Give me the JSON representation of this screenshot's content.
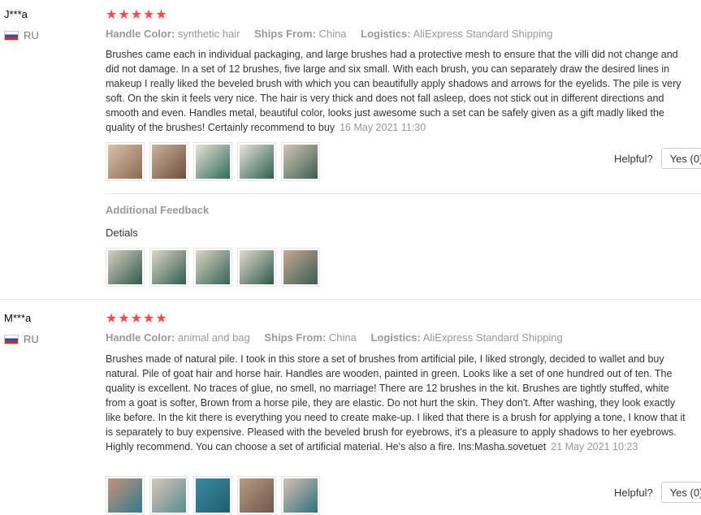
{
  "reviews": [
    {
      "user": "J***a",
      "country": "RU",
      "stars": "★★★★★",
      "attrs": {
        "handle_label": "Handle Color:",
        "handle_value": "synthetic hair",
        "ships_label": "Ships From:",
        "ships_value": "China",
        "logistics_label": "Logistics:",
        "logistics_value": "AliExpress Standard Shipping"
      },
      "text": "Brushes came each in individual packaging, and large brushes had a protective mesh to ensure that the villi did not change and did not damage. In a set of 12 brushes, five large and six small. With each brush, you can separately draw the desired lines in makeup I really liked the beveled brush with which you can beautifully apply shadows and arrows for the eyelids. The pile is very soft. On the skin it feels very nice. The hair is very thick and does not fall asleep, does not stick out in different directions and smooth and even. Handles metal, beautiful color, looks just awesome such a set can be safely given as a gift madly liked the quality of the brushes! Certainly recommend to buy",
      "date": "16 May 2021 11:30",
      "helpful_label": "Helpful?",
      "yes_label": "Yes (0)",
      "additional_title": "Additional Feedback",
      "additional_text": "Detials"
    },
    {
      "user": "M***a",
      "country": "RU",
      "stars": "★★★★★",
      "attrs": {
        "handle_label": "Handle Color:",
        "handle_value": "animal and bag",
        "ships_label": "Ships From:",
        "ships_value": "China",
        "logistics_label": "Logistics:",
        "logistics_value": "AliExpress Standard Shipping"
      },
      "text": "Brushes made of natural pile. I took in this store a set of brushes from artificial pile, I liked strongly, decided to wallet and buy natural. Pile of goat hair and horse hair. Handles are wooden, painted in green. Looks like a set of one hundred out of ten. The quality is excellent. No traces of glue, no smell, no marriage! There are 12 brushes in the kit. Brushes are tightly stuffed, white from a goat is softer, Brown from a horse pile, they are elastic. Do not hurt the skin. They don't. After washing, they look exactly like before. In the kit there is everything you need to create make-up. I liked that there is a brush for applying a tone, I know that it is separately to buy expensive. Pleased with the beveled brush for eyebrows, it's a pleasure to apply shadows to her eyebrows. Highly recommend. You can choose a set of artificial material. He's also a fire. Ins:Masha.sovetuet",
      "date": "21 May 2021 10:23",
      "helpful_label": "Helpful?",
      "yes_label": "Yes (0)"
    }
  ]
}
